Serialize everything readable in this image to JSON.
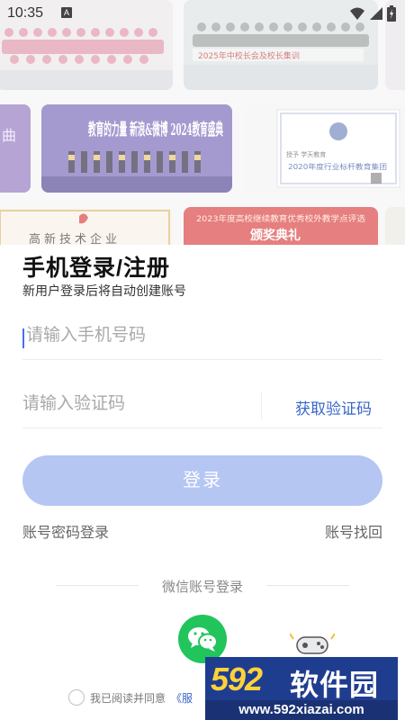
{
  "status_bar": {
    "time": "10:35",
    "notification_letter": "A"
  },
  "banner": {
    "photos": [
      {
        "caption": "2025年中校长会及校长集训"
      },
      {
        "caption": "教育的力量 新浪&微博 2024教育盛典"
      },
      {
        "caption": "2020年度行业标杆教育集团"
      },
      {
        "caption": "高新技术企业"
      },
      {
        "caption": "2023年度高校继续教育优秀校外教学点评选"
      },
      {
        "caption": "颁奖典礼"
      }
    ]
  },
  "login": {
    "title": "手机登录/注册",
    "subtitle": "新用户登录后将自动创建账号",
    "phone_placeholder": "请输入手机号码",
    "code_placeholder": "请输入验证码",
    "get_code_label": "获取验证码",
    "login_button": "登录",
    "password_login_link": "账号密码登录",
    "recover_account_link": "账号找回",
    "third_party_label": "微信账号登录",
    "agreement_prefix": "我已阅读并同意",
    "agreement_link": "《服"
  },
  "watermark": {
    "logo": "592",
    "name": "软件园",
    "url": "www.592xiazai.com"
  },
  "colors": {
    "accent_blue": "#3a66c8",
    "login_button_disabled": "#b5c6f3",
    "wechat_green": "#21c55c",
    "watermark_bg": "#1f3d8f",
    "watermark_logo": "#ffd23a"
  }
}
